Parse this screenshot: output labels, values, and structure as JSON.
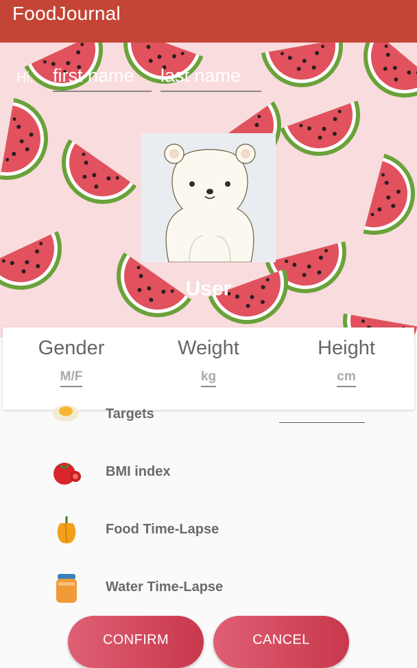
{
  "appbar": {
    "title": "FoodJournal"
  },
  "greeting": {
    "hi": "Hi,",
    "first_name_placeholder": "first name",
    "last_name_placeholder": "last name"
  },
  "profile": {
    "username": "User"
  },
  "stats": [
    {
      "label": "Gender",
      "unit": "M/F"
    },
    {
      "label": "Weight",
      "unit": "kg"
    },
    {
      "label": "Height",
      "unit": "cm"
    }
  ],
  "menu": [
    {
      "label": "Targets",
      "icon": "egg-icon"
    },
    {
      "label": "BMI index",
      "icon": "tomato-icon"
    },
    {
      "label": "Food Time-Lapse",
      "icon": "pepper-icon"
    },
    {
      "label": "Water Time-Lapse",
      "icon": "juice-jar-icon"
    }
  ],
  "buttons": {
    "confirm": "CONFIRM",
    "cancel": "CANCEL"
  },
  "colors": {
    "appbar": "#c44536",
    "header_bg": "#f9dcde",
    "button": "#d44a5e"
  }
}
